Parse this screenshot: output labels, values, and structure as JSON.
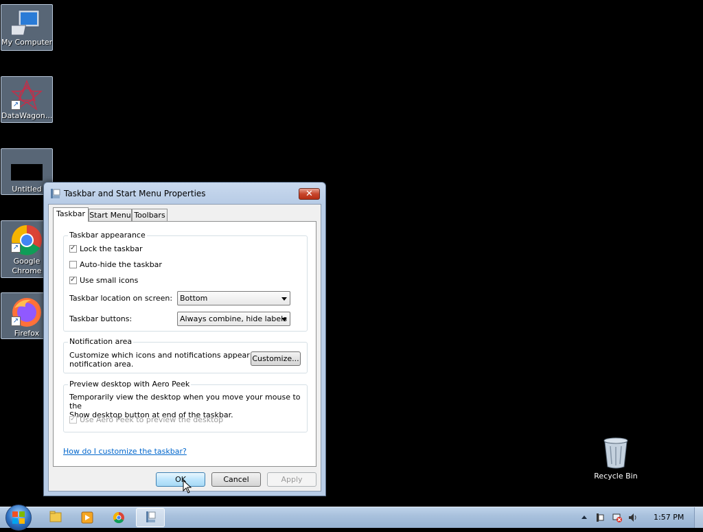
{
  "desktop": {
    "icons": [
      {
        "label": "My Computer",
        "icon": "computer-icon"
      },
      {
        "label": "DataWagon...",
        "icon": "datawagon-icon"
      },
      {
        "label": "Untitled",
        "icon": "document-icon"
      },
      {
        "label": "Google Chrome",
        "icon": "chrome-icon"
      },
      {
        "label": "Firefox",
        "icon": "firefox-icon"
      }
    ],
    "recycle_bin": {
      "label": "Recycle Bin",
      "icon": "recycle-bin-icon"
    }
  },
  "dialog": {
    "title": "Taskbar and Start Menu Properties",
    "close_glyph": "✕",
    "tabs": [
      {
        "label": "Taskbar",
        "active": true
      },
      {
        "label": "Start Menu",
        "active": false
      },
      {
        "label": "Toolbars",
        "active": false
      }
    ],
    "taskbar_appearance": {
      "title": "Taskbar appearance",
      "lock_taskbar": {
        "label": "Lock the taskbar",
        "checked": true
      },
      "auto_hide": {
        "label": "Auto-hide the taskbar",
        "checked": false
      },
      "small_icons": {
        "label": "Use small icons",
        "checked": true
      },
      "location_label": "Taskbar location on screen:",
      "location_value": "Bottom",
      "buttons_label": "Taskbar buttons:",
      "buttons_value": "Always combine, hide labels"
    },
    "notification_area": {
      "title": "Notification area",
      "description_line1": "Customize which icons and notifications appear in the",
      "description_line2": "notification area.",
      "customize_label": "Customize..."
    },
    "aero_peek": {
      "title": "Preview desktop with Aero Peek",
      "description_line1": "Temporarily view the desktop when you move your mouse to the",
      "description_line2": "Show desktop button at end of the taskbar.",
      "use_aero_peek": {
        "label": "Use Aero Peek to preview the desktop",
        "checked": true,
        "disabled": true
      }
    },
    "help_link": "How do I customize the taskbar?",
    "buttons": {
      "ok": "OK",
      "cancel": "Cancel",
      "apply": "Apply"
    }
  },
  "taskbar": {
    "items": [
      "file-explorer-icon",
      "media-player-icon",
      "chrome-icon",
      "taskbar-properties-icon"
    ],
    "clock": "1:57 PM"
  },
  "colors": {
    "desktop_bg": "#000000",
    "accent": "#3c7fb1",
    "link": "#0066cc"
  }
}
